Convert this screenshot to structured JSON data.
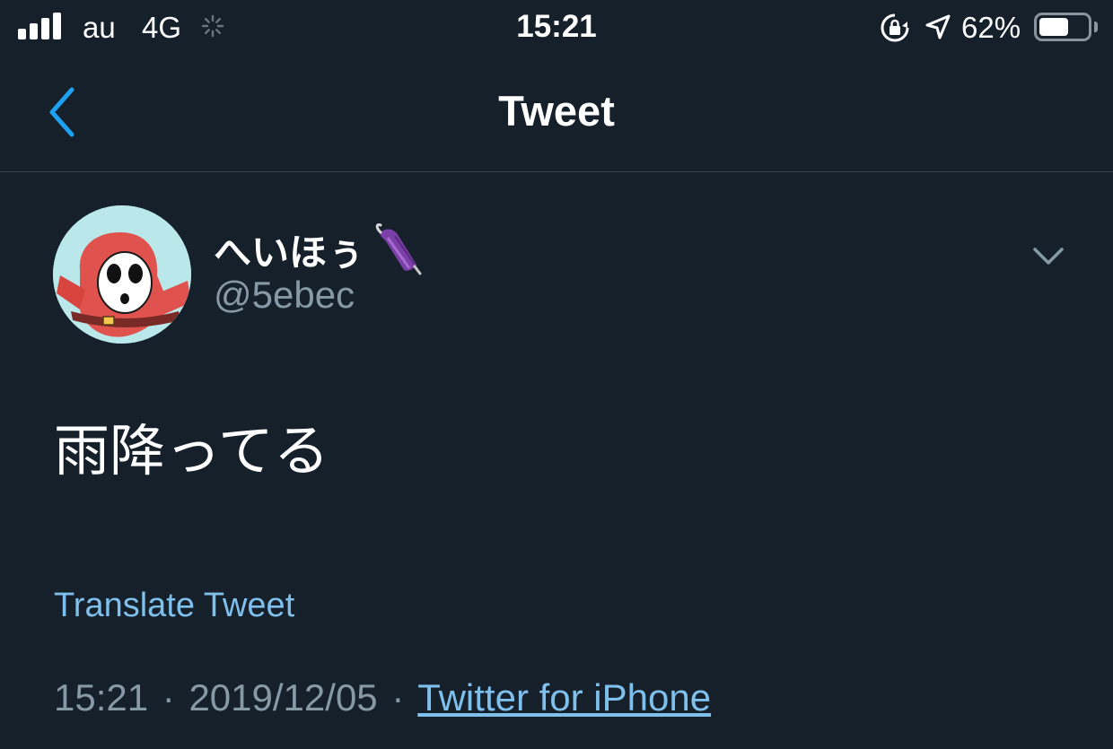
{
  "status_bar": {
    "carrier": "au",
    "network": "4G",
    "time": "15:21",
    "battery_percent": "62%",
    "battery_level": 0.62,
    "icons": [
      "signal-bars-icon",
      "loading-spinner-icon",
      "rotation-lock-icon",
      "location-arrow-icon",
      "battery-icon"
    ]
  },
  "nav": {
    "title": "Tweet",
    "back_icon": "chevron-left-icon"
  },
  "tweet": {
    "display_name": "へいほぅ",
    "name_emoji": "closed-umbrella-icon",
    "handle": "@5ebec",
    "text": "雨降ってる",
    "translate_label": "Translate Tweet",
    "time": "15:21",
    "separator": "·",
    "date": "2019/12/05",
    "source": "Twitter for iPhone",
    "menu_icon": "chevron-down-icon"
  },
  "colors": {
    "background": "#15202b",
    "divider": "#38444d",
    "text_primary": "#ffffff",
    "text_secondary": "#8899a6",
    "link": "#7fbfeb"
  }
}
